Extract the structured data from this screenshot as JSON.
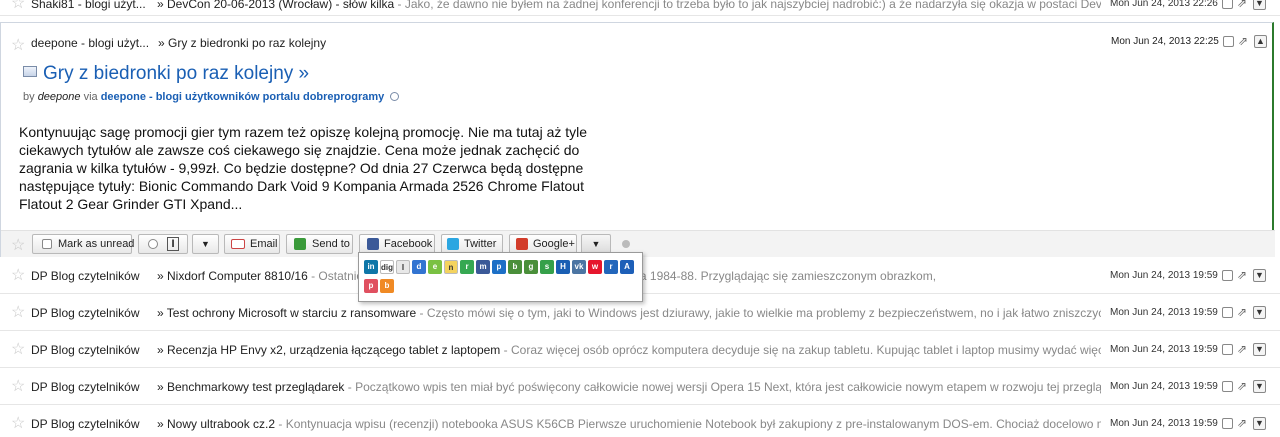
{
  "top_item": {
    "source": "Shaki81 - blogi użyt...",
    "title": "» DevCon 20-06-2013 (Wrocław) - słów kilka",
    "snippet": " - Jako, że dawno nie byłem na żadnej konferencji to trzeba było to jak najszybciej nadrobić:) a że nadarzyła się okazja w postaci DevCon",
    "date": "Mon Jun 24, 2013 22:26"
  },
  "expanded": {
    "source": "deepone - blogi użyt...",
    "title_small": "» Gry z biedronki po raz kolejny",
    "date": "Mon Jun 24, 2013 22:25",
    "title": "Gry z biedronki po raz kolejny »",
    "by_label": "by",
    "author": "deepone",
    "via_label": "via",
    "blog": "deepone - blogi użytkowników portalu dobreprogramy",
    "body": "Kontynuując sagę promocji gier tym razem też opiszę kolejną promocję. Nie ma tutaj aż tyle ciekawych tytułów ale zawsze coś ciekawego się znajdzie. Cena może jednak zachęcić do zagrania w kilka tytułów - 9,99zł. Co będzie dostępne? Od dnia 27 Czerwca będą dostępne następujące tytuły: Bionic Commando Dark Void 9 Kompania Armada 2526 Chrome Flatout Flatout 2 Gear Grinder GTI Xpand..."
  },
  "actions": {
    "mark_as_unread": "Mark as unread",
    "rating": "I",
    "email": "Email",
    "send_to": "Send to",
    "facebook": "Facebook",
    "twitter": "Twitter",
    "google_plus": "Google+"
  },
  "share_services": [
    {
      "icon": "linkedin-icon",
      "color": "#0e76a8",
      "glyph": "in"
    },
    {
      "icon": "digg-icon",
      "color": "#ffffff",
      "glyph": "digg"
    },
    {
      "icon": "instapaper-icon",
      "color": "#e8e8e8",
      "glyph": "I"
    },
    {
      "icon": "delicious-icon",
      "color": "#3274d1",
      "glyph": "d"
    },
    {
      "icon": "evernote-icon",
      "color": "#7ac142",
      "glyph": "e"
    },
    {
      "icon": "notes-icon",
      "color": "#f4d35e",
      "glyph": "n"
    },
    {
      "icon": "readability-icon",
      "color": "#36a852",
      "glyph": "r"
    },
    {
      "icon": "myspace-icon",
      "color": "#3b5998",
      "glyph": "m"
    },
    {
      "icon": "pinboard-icon",
      "color": "#1c6fc6",
      "glyph": "p"
    },
    {
      "icon": "blogger-icon",
      "color": "#4a8f3a",
      "glyph": "b"
    },
    {
      "icon": "google-icon",
      "color": "#4a8f3a",
      "glyph": "g"
    },
    {
      "icon": "bookmark-icon",
      "color": "#35a04a",
      "glyph": "s"
    },
    {
      "icon": "hatena-icon",
      "color": "#1a5fb4",
      "glyph": "H"
    },
    {
      "icon": "vk-icon",
      "color": "#4c75a3",
      "glyph": "vk"
    },
    {
      "icon": "weibo-icon",
      "color": "#e6162d",
      "glyph": "w"
    },
    {
      "icon": "renren-icon",
      "color": "#2266bb",
      "glyph": "r"
    },
    {
      "icon": "navigator-icon",
      "color": "#1d5fb8",
      "glyph": "A"
    },
    {
      "icon": "pocket-icon",
      "color": "#e05060",
      "glyph": "p"
    },
    {
      "icon": "blog-icon",
      "color": "#f08a24",
      "glyph": "b"
    }
  ],
  "items": [
    {
      "source": "DP Blog czytelników",
      "title": "» Nixdorf Computer 8810/16",
      "snippet": " - Ostatnio … komputer produkcji niemieckiej, datowanej na lata 1984-88. Przyglądając się zamieszczonym obrazkom,",
      "date": "Mon Jun 24, 2013 19:59"
    },
    {
      "source": "DP Blog czytelników",
      "title": "» Test ochrony Microsoft w starciu z ransomware",
      "snippet": " - Często mówi się o tym, jaki to Windows jest dziurawy, jakie to wielkie ma problemy z bezpieczeństwem, no i jak łatwo zniszczyć",
      "date": "Mon Jun 24, 2013 19:59"
    },
    {
      "source": "DP Blog czytelników",
      "title": "» Recenzja HP Envy x2, urządzenia łączącego tablet z laptopem",
      "snippet": " - Coraz więcej osób oprócz komputera decyduje się na zakup tabletu. Kupując tablet i laptop musimy wydać więcej,",
      "date": "Mon Jun 24, 2013 19:59"
    },
    {
      "source": "DP Blog czytelników",
      "title": "» Benchmarkowy test przeglądarek",
      "snippet": " - Początkowo wpis ten miał być poświęcony całkowicie nowej wersji Opera 15 Next, która jest całkowicie nowym etapem w rozwoju tej przeglądar",
      "date": "Mon Jun 24, 2013 19:59"
    },
    {
      "source": "DP Blog czytelników",
      "title": "» Nowy ultrabook cz.2",
      "snippet": " - Kontynuacja wpisu (recenzji) notebooka ASUS K56CB Pierwsze uruchomienie Notebook był zakupiony z pre-instalowanym DOS-em. Chociaż docelowo miał",
      "date": "Mon Jun 24, 2013 19:59"
    }
  ]
}
